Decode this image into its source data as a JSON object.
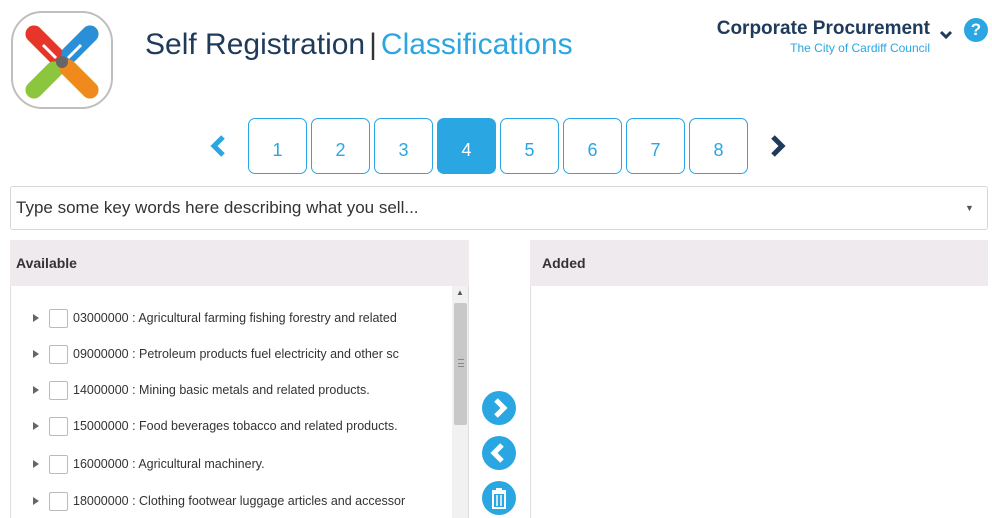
{
  "header": {
    "title": "Self Registration",
    "separator": "|",
    "section": "Classifications",
    "org_name": "Corporate Procurement",
    "org_sub": "The City of Cardiff Council",
    "help_label": "?"
  },
  "stepper": {
    "steps": [
      "1",
      "2",
      "3",
      "4",
      "5",
      "6",
      "7",
      "8"
    ],
    "active": "4"
  },
  "search": {
    "placeholder": "Type some key words here describing what you sell...",
    "value": ""
  },
  "available": {
    "header": "Available",
    "items": [
      {
        "label": "03000000 : Agricultural farming fishing forestry and related"
      },
      {
        "label": "09000000 : Petroleum products fuel electricity and other sc"
      },
      {
        "label": "14000000 : Mining basic metals and related products."
      },
      {
        "label": "15000000 : Food beverages tobacco and related products."
      },
      {
        "label": "16000000 : Agricultural machinery."
      },
      {
        "label": "18000000 : Clothing footwear luggage articles and accessor"
      }
    ]
  },
  "added": {
    "header": "Added",
    "items": []
  },
  "colors": {
    "accent": "#2aa6e2",
    "title": "#1f3a5a",
    "panel_header_bg": "#eeeaee"
  },
  "icons": {
    "prev": "chevron-left-icon",
    "next": "chevron-right-icon",
    "org_menu": "chevron-down-icon",
    "help": "help-icon",
    "add": "arrow-right-circle-icon",
    "remove": "arrow-left-circle-icon",
    "delete": "trash-icon"
  }
}
